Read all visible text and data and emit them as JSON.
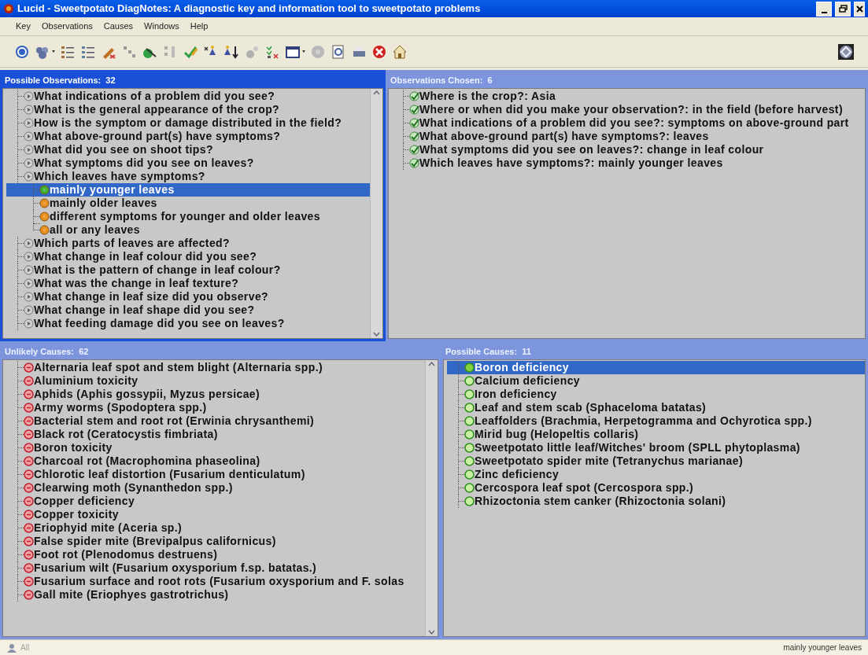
{
  "window": {
    "title": "Lucid - Sweetpotato DiagNotes: A diagnostic key and information tool to sweetpotato problems"
  },
  "menu": [
    "Key",
    "Observations",
    "Causes",
    "Windows",
    "Help"
  ],
  "panels": [
    {
      "title": "Possible Observations:  32",
      "active": true,
      "scrollbar": true,
      "kind": "questions",
      "items": [
        {
          "label": "What indications of a problem did you see?",
          "selected": false
        },
        {
          "label": "What is the general appearance of the crop?",
          "selected": false
        },
        {
          "label": "How is the symptom or damage distributed in the field?",
          "selected": false
        },
        {
          "label": "What above-ground part(s) have symptoms?",
          "selected": false
        },
        {
          "label": "What did you see on shoot tips?",
          "selected": false
        },
        {
          "label": "What symptoms did you see on leaves?",
          "selected": false
        },
        {
          "label": "Which leaves have symptoms?",
          "selected": false,
          "children": [
            {
              "label": "mainly younger leaves",
              "selected": true
            },
            {
              "label": "mainly older leaves",
              "selected": false
            },
            {
              "label": "different symptoms for younger and older leaves",
              "selected": false
            },
            {
              "label": "all or any leaves",
              "selected": false
            }
          ]
        },
        {
          "label": "Which parts of leaves are affected?",
          "selected": false
        },
        {
          "label": "What change in leaf colour did you see?",
          "selected": false
        },
        {
          "label": "What is the pattern of change in leaf colour?",
          "selected": false
        },
        {
          "label": "What was the change in leaf texture?",
          "selected": false
        },
        {
          "label": "What change in leaf size did you observe?",
          "selected": false
        },
        {
          "label": "What change in leaf shape did you see?",
          "selected": false
        },
        {
          "label": "What feeding damage did you see on leaves?",
          "selected": false
        }
      ]
    },
    {
      "title": "Observations Chosen:  6",
      "active": false,
      "scrollbar": false,
      "kind": "chosen",
      "items": [
        {
          "label": "Where is the crop?: Asia",
          "selected": false
        },
        {
          "label": "Where or when did you make your observation?: in the field  (before harvest)",
          "selected": false
        },
        {
          "label": "What indications of a problem did you see?: symptoms on above-ground part",
          "selected": false
        },
        {
          "label": "What above-ground part(s) have symptoms?: leaves",
          "selected": false
        },
        {
          "label": "What symptoms did you see on leaves?: change in leaf colour",
          "selected": false
        },
        {
          "label": "Which leaves have symptoms?: mainly younger leaves",
          "selected": false
        }
      ]
    },
    {
      "title": "Unlikely Causes:  62",
      "active": false,
      "scrollbar": true,
      "kind": "unlikely",
      "items": [
        {
          "label": "Alternaria leaf spot and stem blight (Alternaria spp.)",
          "selected": false
        },
        {
          "label": "Aluminium toxicity",
          "selected": false
        },
        {
          "label": "Aphids (Aphis gossypii, Myzus persicae)",
          "selected": false
        },
        {
          "label": "Army worms (Spodoptera spp.)",
          "selected": false
        },
        {
          "label": "Bacterial stem and root rot (Erwinia chrysanthemi)",
          "selected": false
        },
        {
          "label": "Black rot (Ceratocystis fimbriata)",
          "selected": false
        },
        {
          "label": "Boron toxicity",
          "selected": false
        },
        {
          "label": "Charcoal rot (Macrophomina phaseolina)",
          "selected": false
        },
        {
          "label": "Chlorotic leaf distortion (Fusarium denticulatum)",
          "selected": false
        },
        {
          "label": "Clearwing moth (Synanthedon spp.)",
          "selected": false
        },
        {
          "label": "Copper deficiency",
          "selected": false
        },
        {
          "label": "Copper toxicity",
          "selected": false
        },
        {
          "label": "Eriophyid mite (Aceria sp.)",
          "selected": false
        },
        {
          "label": "False spider mite (Brevipalpus californicus)",
          "selected": false
        },
        {
          "label": "Foot rot (Plenodomus destruens)",
          "selected": false
        },
        {
          "label": "Fusarium wilt (Fusarium oxysporium f.sp. batatas.)",
          "selected": false
        },
        {
          "label": "Fusarium surface and root rots (Fusarium oxysporium and F. solas",
          "selected": false
        },
        {
          "label": "Gall mite (Eriophyes gastrotrichus)",
          "selected": false
        }
      ]
    },
    {
      "title": "Possible Causes:  11",
      "active": false,
      "scrollbar": false,
      "kind": "possible",
      "items": [
        {
          "label": "Boron deficiency",
          "selected": true
        },
        {
          "label": "Calcium deficiency",
          "selected": false
        },
        {
          "label": "Iron deficiency",
          "selected": false
        },
        {
          "label": "Leaf and stem scab (Sphaceloma batatas)",
          "selected": false
        },
        {
          "label": "Leaffolders (Brachmia, Herpetogramma and Ochyrotica spp.)",
          "selected": false
        },
        {
          "label": "Mirid bug (Helopeltis collaris)",
          "selected": false
        },
        {
          "label": "Sweetpotato little leaf/Witches' broom (SPLL phytoplasma)",
          "selected": false
        },
        {
          "label": "Sweetpotato spider mite (Tetranychus marianae)",
          "selected": false
        },
        {
          "label": "Zinc deficiency",
          "selected": false
        },
        {
          "label": "Cercospora leaf spot (Cercospora spp.)",
          "selected": false
        },
        {
          "label": "Rhizoctonia stem canker (Rhizoctonia solani)",
          "selected": false
        }
      ]
    }
  ],
  "status_bar": {
    "left": "All",
    "right": "mainly younger leaves"
  }
}
